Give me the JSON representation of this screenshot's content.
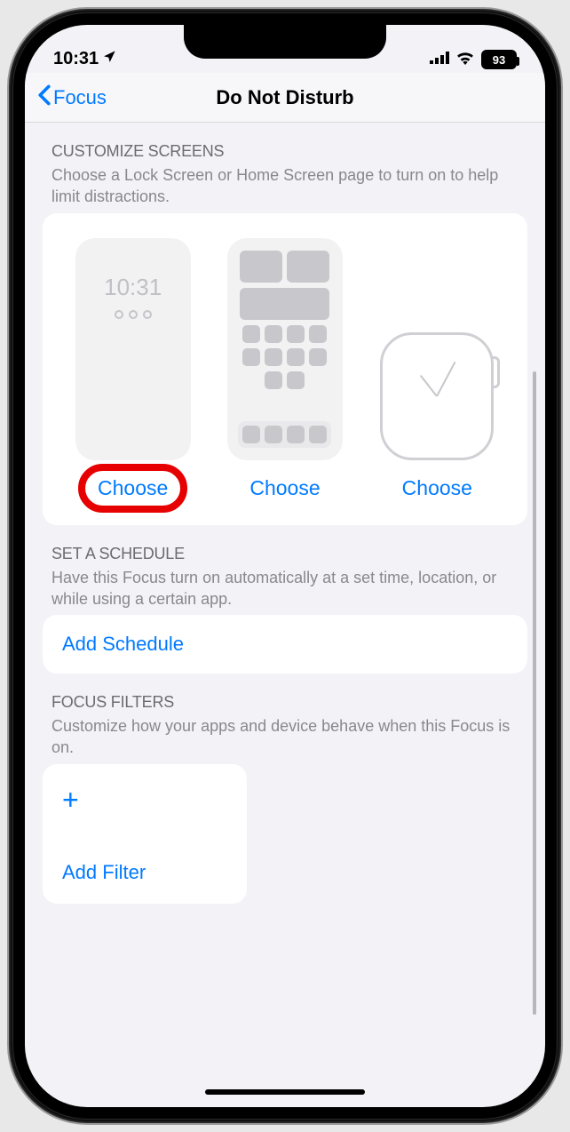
{
  "status": {
    "time": "10:31",
    "battery": "93"
  },
  "nav": {
    "back": "Focus",
    "title": "Do Not Disturb"
  },
  "customize": {
    "title": "CUSTOMIZE SCREENS",
    "sub": "Choose a Lock Screen or Home Screen page to turn on to help limit distractions.",
    "lock_time": "10:31",
    "choose": "Choose"
  },
  "schedule": {
    "title": "SET A SCHEDULE",
    "sub": "Have this Focus turn on automatically at a set time, location, or while using a certain app.",
    "add": "Add Schedule"
  },
  "filters": {
    "title": "FOCUS FILTERS",
    "sub": "Customize how your apps and device behave when this Focus is on.",
    "add": "Add Filter"
  }
}
